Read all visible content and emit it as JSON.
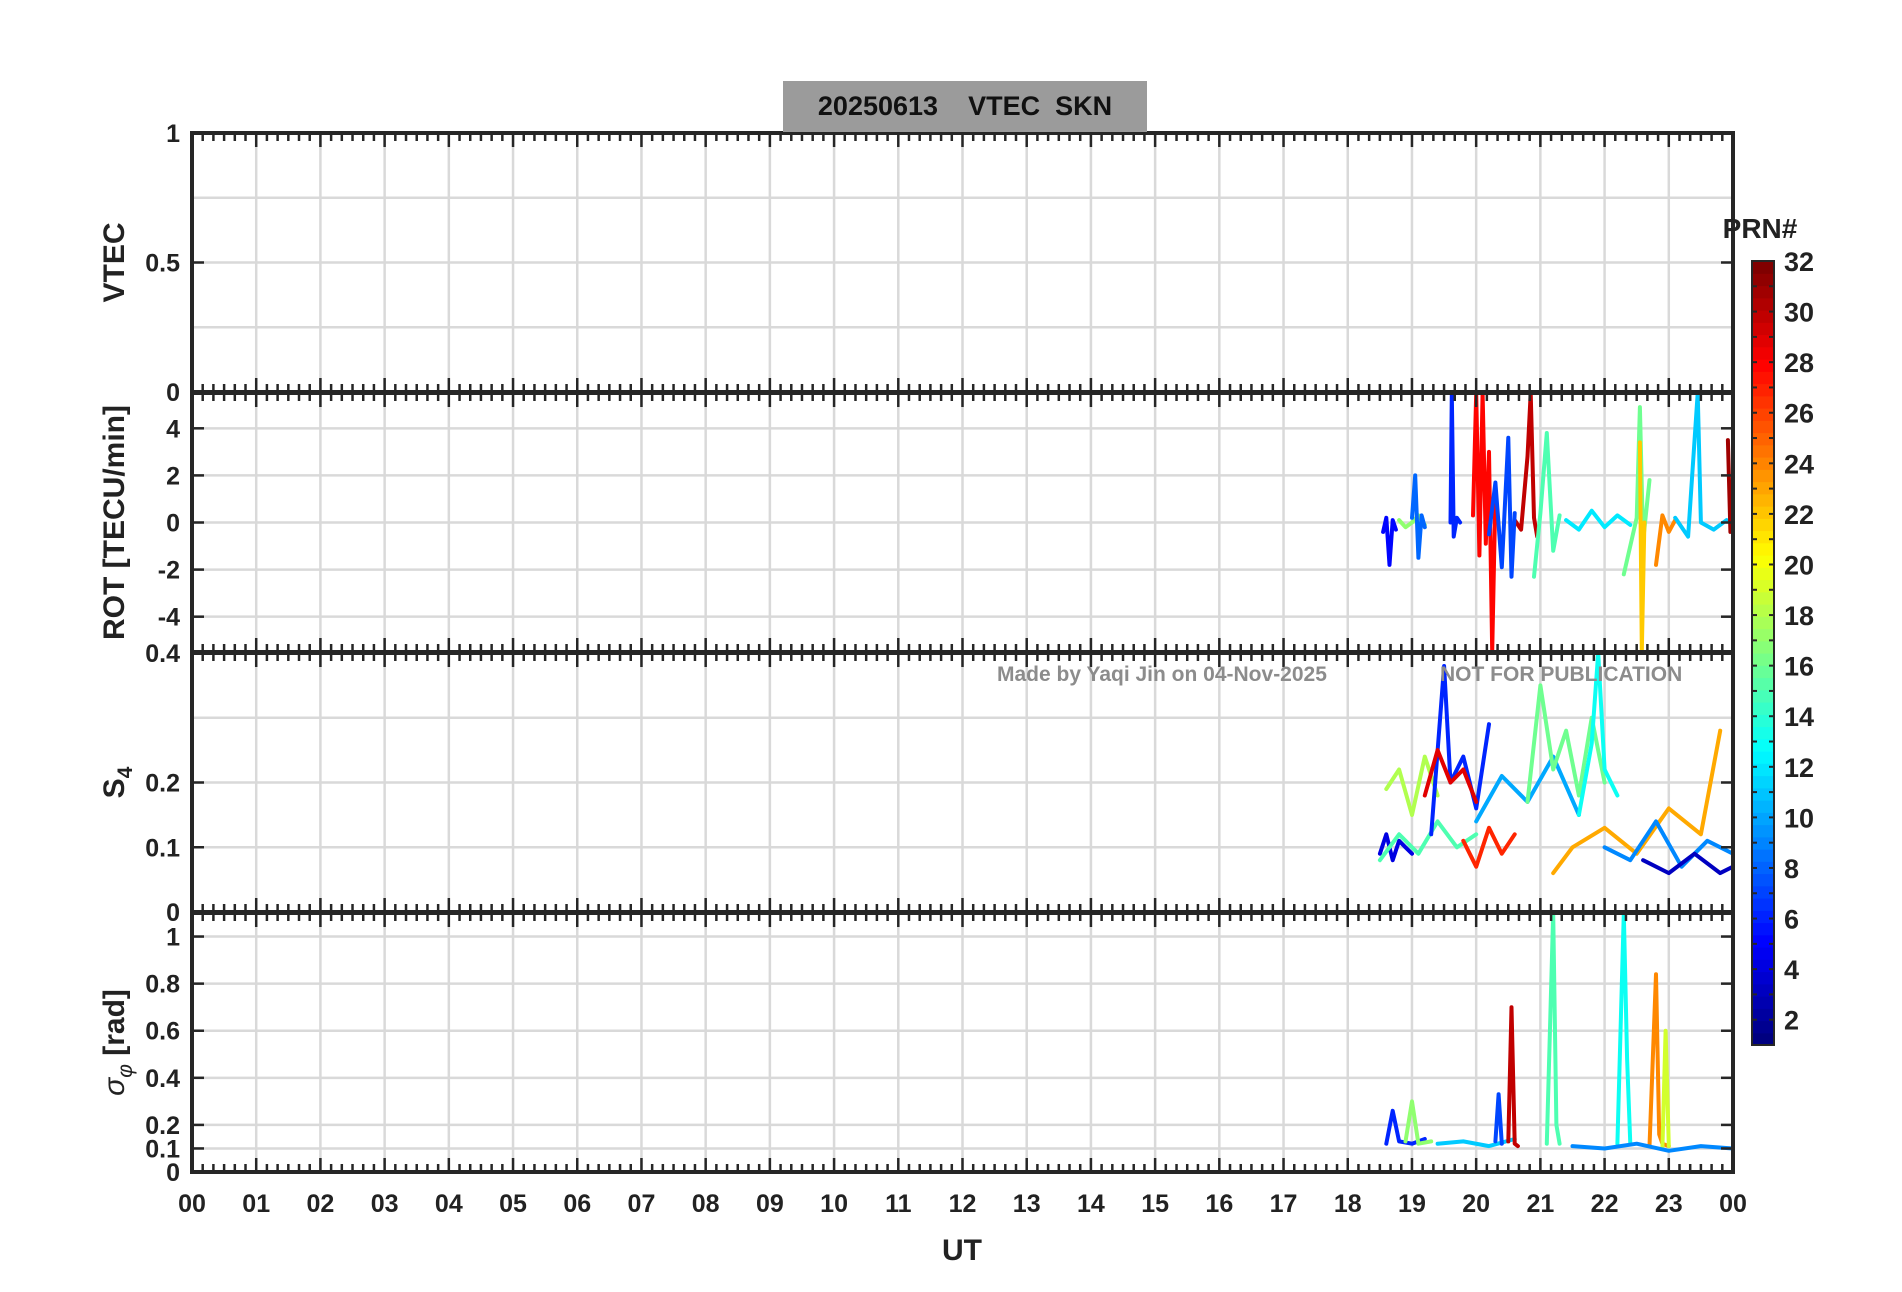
{
  "title": {
    "date": "20250613",
    "text": "VTEC  SKN"
  },
  "watermark": {
    "left": "Made by Yaqi Jin on 04-Nov-2025",
    "right": "NOT FOR PUBLICATION"
  },
  "colorbar": {
    "label": "PRN#",
    "ticks": [
      "32",
      "30",
      "28",
      "26",
      "24",
      "22",
      "20",
      "18",
      "16",
      "14",
      "12",
      "10",
      "8",
      "6",
      "4",
      "2"
    ],
    "range": [
      1,
      32
    ],
    "colormap": "jet"
  },
  "xaxis": {
    "label": "UT",
    "range": [
      0,
      24
    ],
    "tick_labels": [
      "00",
      "01",
      "02",
      "03",
      "04",
      "05",
      "06",
      "07",
      "08",
      "09",
      "10",
      "11",
      "12",
      "13",
      "14",
      "15",
      "16",
      "17",
      "18",
      "19",
      "20",
      "21",
      "22",
      "23",
      "00"
    ]
  },
  "chart_data": [
    {
      "type": "line",
      "panel": "vtec",
      "ylabel": "VTEC",
      "ylim": [
        0,
        1
      ],
      "ytick_labels": [
        "1",
        "0.5",
        "0"
      ],
      "series": []
    },
    {
      "type": "line",
      "panel": "rot",
      "ylabel": "ROT [TECU/min]",
      "ylim": [
        -5.5,
        5.5
      ],
      "ytick_labels": [
        "4",
        "2",
        "0",
        "-2",
        "-4"
      ],
      "series": [
        {
          "prn": 5,
          "x": [
            18.55,
            18.6,
            18.65,
            18.7,
            18.75
          ],
          "y": [
            -0.4,
            0.2,
            -1.8,
            0.1,
            -0.3
          ]
        },
        {
          "prn": 17,
          "x": [
            18.8,
            18.9,
            19.0,
            19.1,
            19.2
          ],
          "y": [
            0.1,
            -0.2,
            0.0,
            0.3,
            -0.1
          ]
        },
        {
          "prn": 8,
          "x": [
            19.0,
            19.05,
            19.1,
            19.15,
            19.2
          ],
          "y": [
            0.2,
            2.0,
            -1.5,
            0.3,
            -0.2
          ]
        },
        {
          "prn": 6,
          "x": [
            19.6,
            19.62,
            19.65,
            19.7,
            19.75
          ],
          "y": [
            0.0,
            5.5,
            -0.6,
            0.2,
            0.0
          ]
        },
        {
          "prn": 28,
          "x": [
            19.95,
            20.0,
            20.05,
            20.1,
            20.15,
            20.2,
            20.25,
            20.3
          ],
          "y": [
            0.3,
            5.5,
            -1.4,
            5.5,
            -0.9,
            3.0,
            -5.5,
            1.2
          ]
        },
        {
          "prn": 30,
          "x": [
            20.6,
            20.7,
            20.8,
            20.85,
            20.9,
            20.95
          ],
          "y": [
            0.1,
            -0.3,
            2.8,
            5.5,
            0.2,
            -0.6
          ]
        },
        {
          "prn": 7,
          "x": [
            20.2,
            20.3,
            20.4,
            20.5,
            20.55,
            20.6
          ],
          "y": [
            -0.5,
            1.7,
            -1.9,
            3.6,
            -2.3,
            0.4
          ]
        },
        {
          "prn": 15,
          "x": [
            20.9,
            21.0,
            21.1,
            21.2,
            21.3
          ],
          "y": [
            -2.3,
            0.4,
            3.8,
            -1.2,
            0.3
          ]
        },
        {
          "prn": 12,
          "x": [
            21.4,
            21.6,
            21.8,
            22.0,
            22.2,
            22.4
          ],
          "y": [
            0.1,
            -0.3,
            0.5,
            -0.2,
            0.3,
            -0.1
          ]
        },
        {
          "prn": 16,
          "x": [
            22.3,
            22.5,
            22.55,
            22.6,
            22.7
          ],
          "y": [
            -2.2,
            0.2,
            4.9,
            -0.8,
            1.8
          ]
        },
        {
          "prn": 22,
          "x": [
            22.55,
            22.58,
            22.62
          ],
          "y": [
            3.4,
            -5.5,
            0.0
          ]
        },
        {
          "prn": 24,
          "x": [
            22.8,
            22.9,
            23.0,
            23.1
          ],
          "y": [
            -1.8,
            0.3,
            -0.4,
            0.1
          ]
        },
        {
          "prn": 11,
          "x": [
            23.1,
            23.3,
            23.45,
            23.5,
            23.7,
            23.9
          ],
          "y": [
            0.2,
            -0.6,
            5.5,
            0.0,
            -0.3,
            0.1
          ]
        },
        {
          "prn": 31,
          "x": [
            23.92,
            23.96,
            24.0
          ],
          "y": [
            3.5,
            -0.4,
            0.1
          ]
        }
      ]
    },
    {
      "type": "line",
      "panel": "s4",
      "ylabel": "S4",
      "ylim": [
        0,
        0.4
      ],
      "ytick_labels": [
        "0.4",
        "0.2",
        "0.1",
        "0"
      ],
      "series": [
        {
          "prn": 4,
          "x": [
            18.5,
            18.6,
            18.7,
            18.8,
            18.9,
            19.0
          ],
          "y": [
            0.09,
            0.12,
            0.08,
            0.11,
            0.1,
            0.09
          ]
        },
        {
          "prn": 18,
          "x": [
            18.6,
            18.8,
            19.0,
            19.2,
            19.4
          ],
          "y": [
            0.19,
            0.22,
            0.15,
            0.24,
            0.18
          ]
        },
        {
          "prn": 15,
          "x": [
            18.5,
            18.8,
            19.1,
            19.4,
            19.7,
            20.0
          ],
          "y": [
            0.08,
            0.12,
            0.09,
            0.14,
            0.1,
            0.12
          ]
        },
        {
          "prn": 6,
          "x": [
            19.3,
            19.5,
            19.6,
            19.8,
            20.0,
            20.2
          ],
          "y": [
            0.12,
            0.38,
            0.2,
            0.24,
            0.16,
            0.29
          ]
        },
        {
          "prn": 29,
          "x": [
            19.2,
            19.4,
            19.6,
            19.8,
            20.0
          ],
          "y": [
            0.18,
            0.25,
            0.2,
            0.22,
            0.17
          ]
        },
        {
          "prn": 27,
          "x": [
            19.8,
            20.0,
            20.2,
            20.4,
            20.6
          ],
          "y": [
            0.11,
            0.07,
            0.13,
            0.09,
            0.12
          ]
        },
        {
          "prn": 10,
          "x": [
            20.0,
            20.4,
            20.8,
            21.2,
            21.6
          ],
          "y": [
            0.14,
            0.21,
            0.17,
            0.24,
            0.15
          ]
        },
        {
          "prn": 16,
          "x": [
            20.8,
            21.0,
            21.2,
            21.4,
            21.6,
            21.8,
            22.0
          ],
          "y": [
            0.17,
            0.35,
            0.22,
            0.28,
            0.18,
            0.3,
            0.2
          ]
        },
        {
          "prn": 13,
          "x": [
            21.6,
            21.8,
            21.9,
            22.0,
            22.2
          ],
          "y": [
            0.15,
            0.26,
            0.4,
            0.22,
            0.18
          ]
        },
        {
          "prn": 23,
          "x": [
            21.2,
            21.5,
            22.0,
            22.5,
            23.0,
            23.5,
            23.8
          ],
          "y": [
            0.06,
            0.1,
            0.13,
            0.09,
            0.16,
            0.12,
            0.28
          ]
        },
        {
          "prn": 9,
          "x": [
            22.0,
            22.4,
            22.8,
            23.2,
            23.6,
            24.0
          ],
          "y": [
            0.1,
            0.08,
            0.14,
            0.07,
            0.11,
            0.09
          ]
        },
        {
          "prn": 3,
          "x": [
            22.6,
            23.0,
            23.4,
            23.8,
            24.0
          ],
          "y": [
            0.08,
            0.06,
            0.09,
            0.06,
            0.07
          ]
        }
      ]
    },
    {
      "type": "line",
      "panel": "sigma_phi",
      "ylabel": "σφ [rad]",
      "ylim": [
        0,
        1.1
      ],
      "ytick_labels": [
        "1",
        "0.8",
        "0.6",
        "0.4",
        "0.2",
        "0.1",
        "0"
      ],
      "series": [
        {
          "prn": 6,
          "x": [
            18.6,
            18.7,
            18.8,
            19.0,
            19.2
          ],
          "y": [
            0.12,
            0.26,
            0.13,
            0.12,
            0.14
          ]
        },
        {
          "prn": 17,
          "x": [
            18.9,
            19.0,
            19.1,
            19.3
          ],
          "y": [
            0.13,
            0.3,
            0.12,
            0.13
          ]
        },
        {
          "prn": 11,
          "x": [
            19.4,
            19.8,
            20.2,
            20.6
          ],
          "y": [
            0.12,
            0.13,
            0.11,
            0.14
          ]
        },
        {
          "prn": 30,
          "x": [
            20.5,
            20.55,
            20.6,
            20.65
          ],
          "y": [
            0.13,
            0.7,
            0.12,
            0.11
          ]
        },
        {
          "prn": 7,
          "x": [
            20.3,
            20.35,
            20.4
          ],
          "y": [
            0.13,
            0.33,
            0.12
          ]
        },
        {
          "prn": 15,
          "x": [
            21.1,
            21.2,
            21.25,
            21.3
          ],
          "y": [
            0.12,
            1.1,
            0.2,
            0.12
          ]
        },
        {
          "prn": 13,
          "x": [
            22.2,
            22.3,
            22.35,
            22.4
          ],
          "y": [
            0.12,
            1.1,
            0.48,
            0.12
          ]
        },
        {
          "prn": 24,
          "x": [
            22.7,
            22.8,
            22.85,
            22.9,
            23.0
          ],
          "y": [
            0.11,
            0.84,
            0.16,
            0.12,
            0.11
          ]
        },
        {
          "prn": 19,
          "x": [
            22.9,
            22.95,
            23.0
          ],
          "y": [
            0.1,
            0.6,
            0.11
          ]
        },
        {
          "prn": 9,
          "x": [
            21.5,
            22.0,
            22.5,
            23.0,
            23.5,
            24.0
          ],
          "y": [
            0.11,
            0.1,
            0.12,
            0.09,
            0.11,
            0.1
          ]
        }
      ]
    }
  ]
}
